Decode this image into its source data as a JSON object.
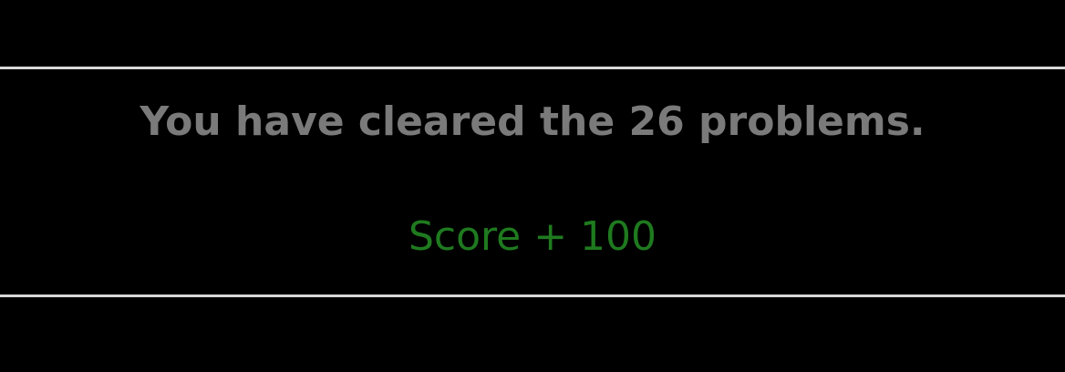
{
  "result": {
    "message": "You have cleared the 26 problems.",
    "score_text": "Score + 100"
  },
  "colors": {
    "background": "#000000",
    "divider": "#d9d9d9",
    "message": "#7a7a7a",
    "score": "#1f7a1f"
  }
}
